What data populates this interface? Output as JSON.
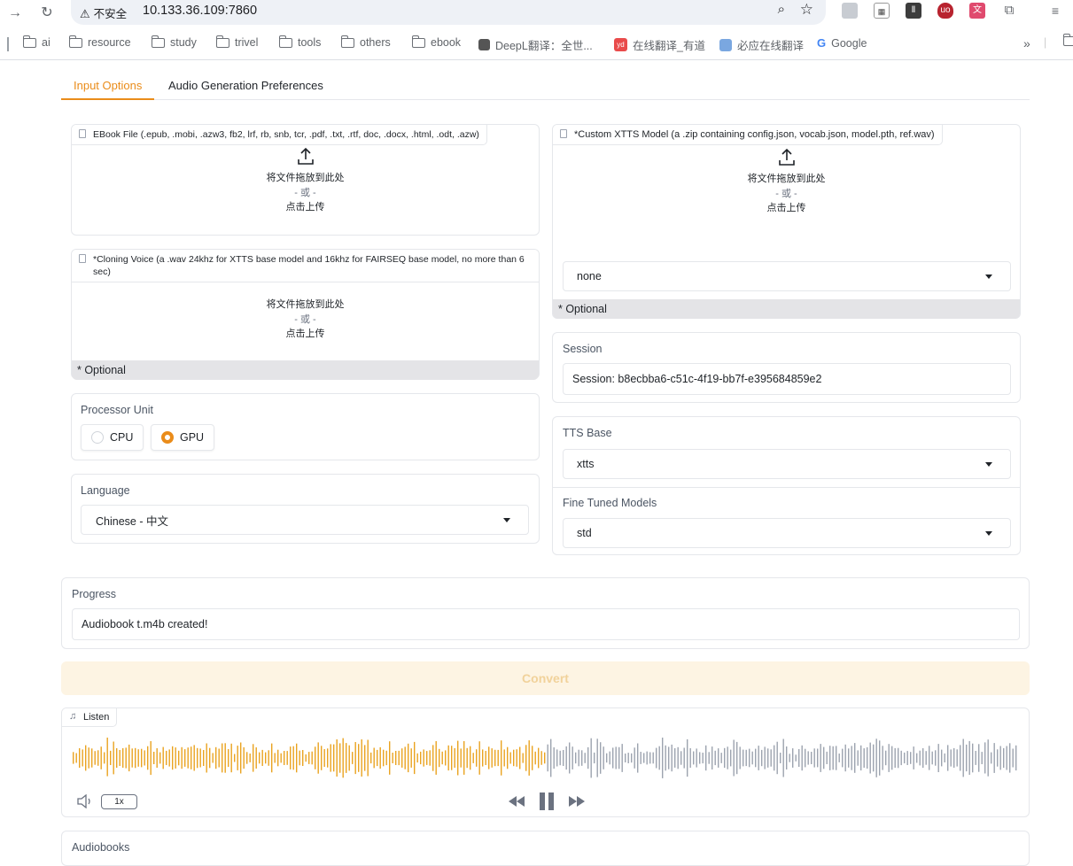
{
  "browser": {
    "security_label": "不安全",
    "url": "10.133.36.109:7860",
    "bookmarks": [
      "ai",
      "resource",
      "study",
      "trivel",
      "tools",
      "others",
      "ebook",
      "DeepL翻译：全世...",
      "在线翻译_有道",
      "必应在线翻译",
      "Google"
    ]
  },
  "tabs": [
    {
      "label": "Input Options",
      "active": true
    },
    {
      "label": "Audio Generation Preferences",
      "active": false
    }
  ],
  "ebook_upload": {
    "label": "EBook File (.epub, .mobi, .azw3, fb2, lrf, rb, snb, tcr, .pdf, .txt, .rtf, doc, .docx, .html, .odt, .azw)",
    "drop_text": "将文件拖放到此处",
    "or_text": "- 或 -",
    "click_text": "点击上传"
  },
  "voice_upload": {
    "label": "*Cloning Voice (a .wav 24khz for XTTS base model and 16khz for FAIRSEQ base model, no more than 6 sec)",
    "drop_text": "将文件拖放到此处",
    "or_text": "- 或 -",
    "click_text": "点击上传",
    "note": "* Optional"
  },
  "processor": {
    "label": "Processor Unit",
    "options": [
      "CPU",
      "GPU"
    ],
    "selected": "GPU"
  },
  "language": {
    "label": "Language",
    "value": "Chinese - 中文"
  },
  "custom_model": {
    "label": "*Custom XTTS Model (a .zip containing config.json, vocab.json, model.pth, ref.wav)",
    "drop_text": "将文件拖放到此处",
    "or_text": "- 或 -",
    "click_text": "点击上传",
    "select_value": "none",
    "note": "* Optional"
  },
  "session": {
    "label": "Session",
    "value": "Session: b8ecbba6-c51c-4f19-bb7f-e395684859e2"
  },
  "tts_base": {
    "label": "TTS Base",
    "value": "xtts"
  },
  "fine_tuned": {
    "label": "Fine Tuned Models",
    "value": "std"
  },
  "progress": {
    "label": "Progress",
    "value": "Audiobook t.m4b created!"
  },
  "convert": {
    "label": "Convert"
  },
  "player": {
    "label": "Listen",
    "speed": "1x",
    "played_fraction": 0.5,
    "played_color": "#eaa320",
    "unplayed_color": "#9ca3af"
  },
  "audiobooks": {
    "label": "Audiobooks"
  },
  "colors": {
    "accent": "#ea8c1a",
    "optional_bg": "#e4e4e7",
    "convert_bg": "#fdf4e3"
  }
}
